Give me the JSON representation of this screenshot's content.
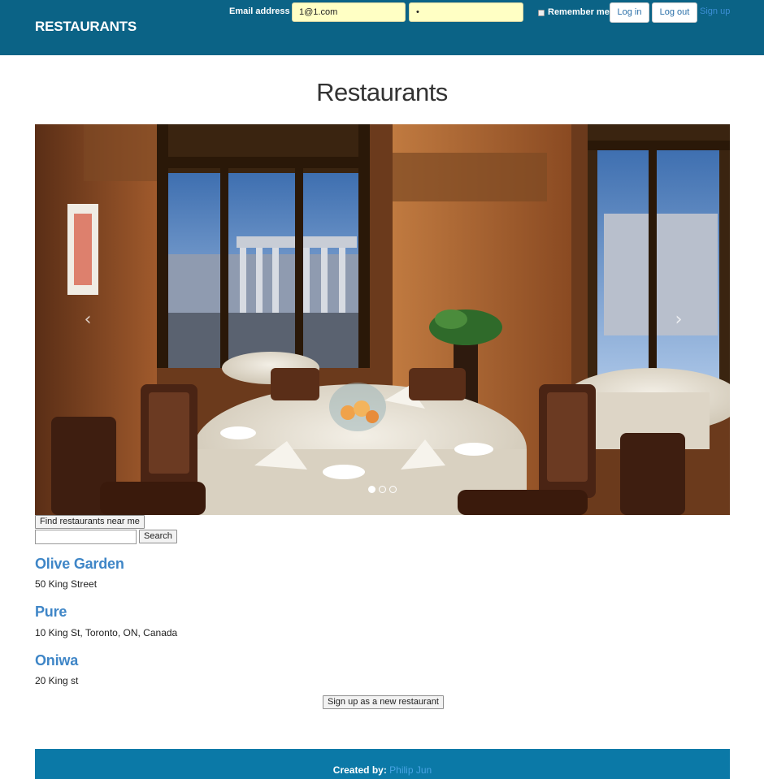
{
  "header": {
    "brand": "RESTAURANTS",
    "email_label": "Email address",
    "email_value": "1@1.com",
    "password_value": "•",
    "remember_label": "Remember me",
    "login_label": "Log in",
    "logout_label": "Log out",
    "signup_label": "Sign up"
  },
  "main": {
    "title": "Restaurants",
    "carousel": {
      "slide_count": 3,
      "active_index": 0,
      "prev_icon": "chevron-left-icon",
      "next_icon": "chevron-right-icon"
    },
    "find_near_label": "Find restaurants near me",
    "search_value": "",
    "search_label": "Search",
    "restaurants": [
      {
        "name": "Olive Garden",
        "address": "50 King Street"
      },
      {
        "name": "Pure",
        "address": "10 King St, Toronto, ON, Canada"
      },
      {
        "name": "Oniwa",
        "address": "20 King st"
      }
    ],
    "signup_restaurant_label": "Sign up as a new restaurant"
  },
  "footer": {
    "created_by_label": "Created by:",
    "author": "Philip Jun"
  },
  "colors": {
    "navbar": "#0b6386",
    "footer": "#0b79a7",
    "link": "#3f86c7",
    "input_bg": "#ffffc4"
  }
}
